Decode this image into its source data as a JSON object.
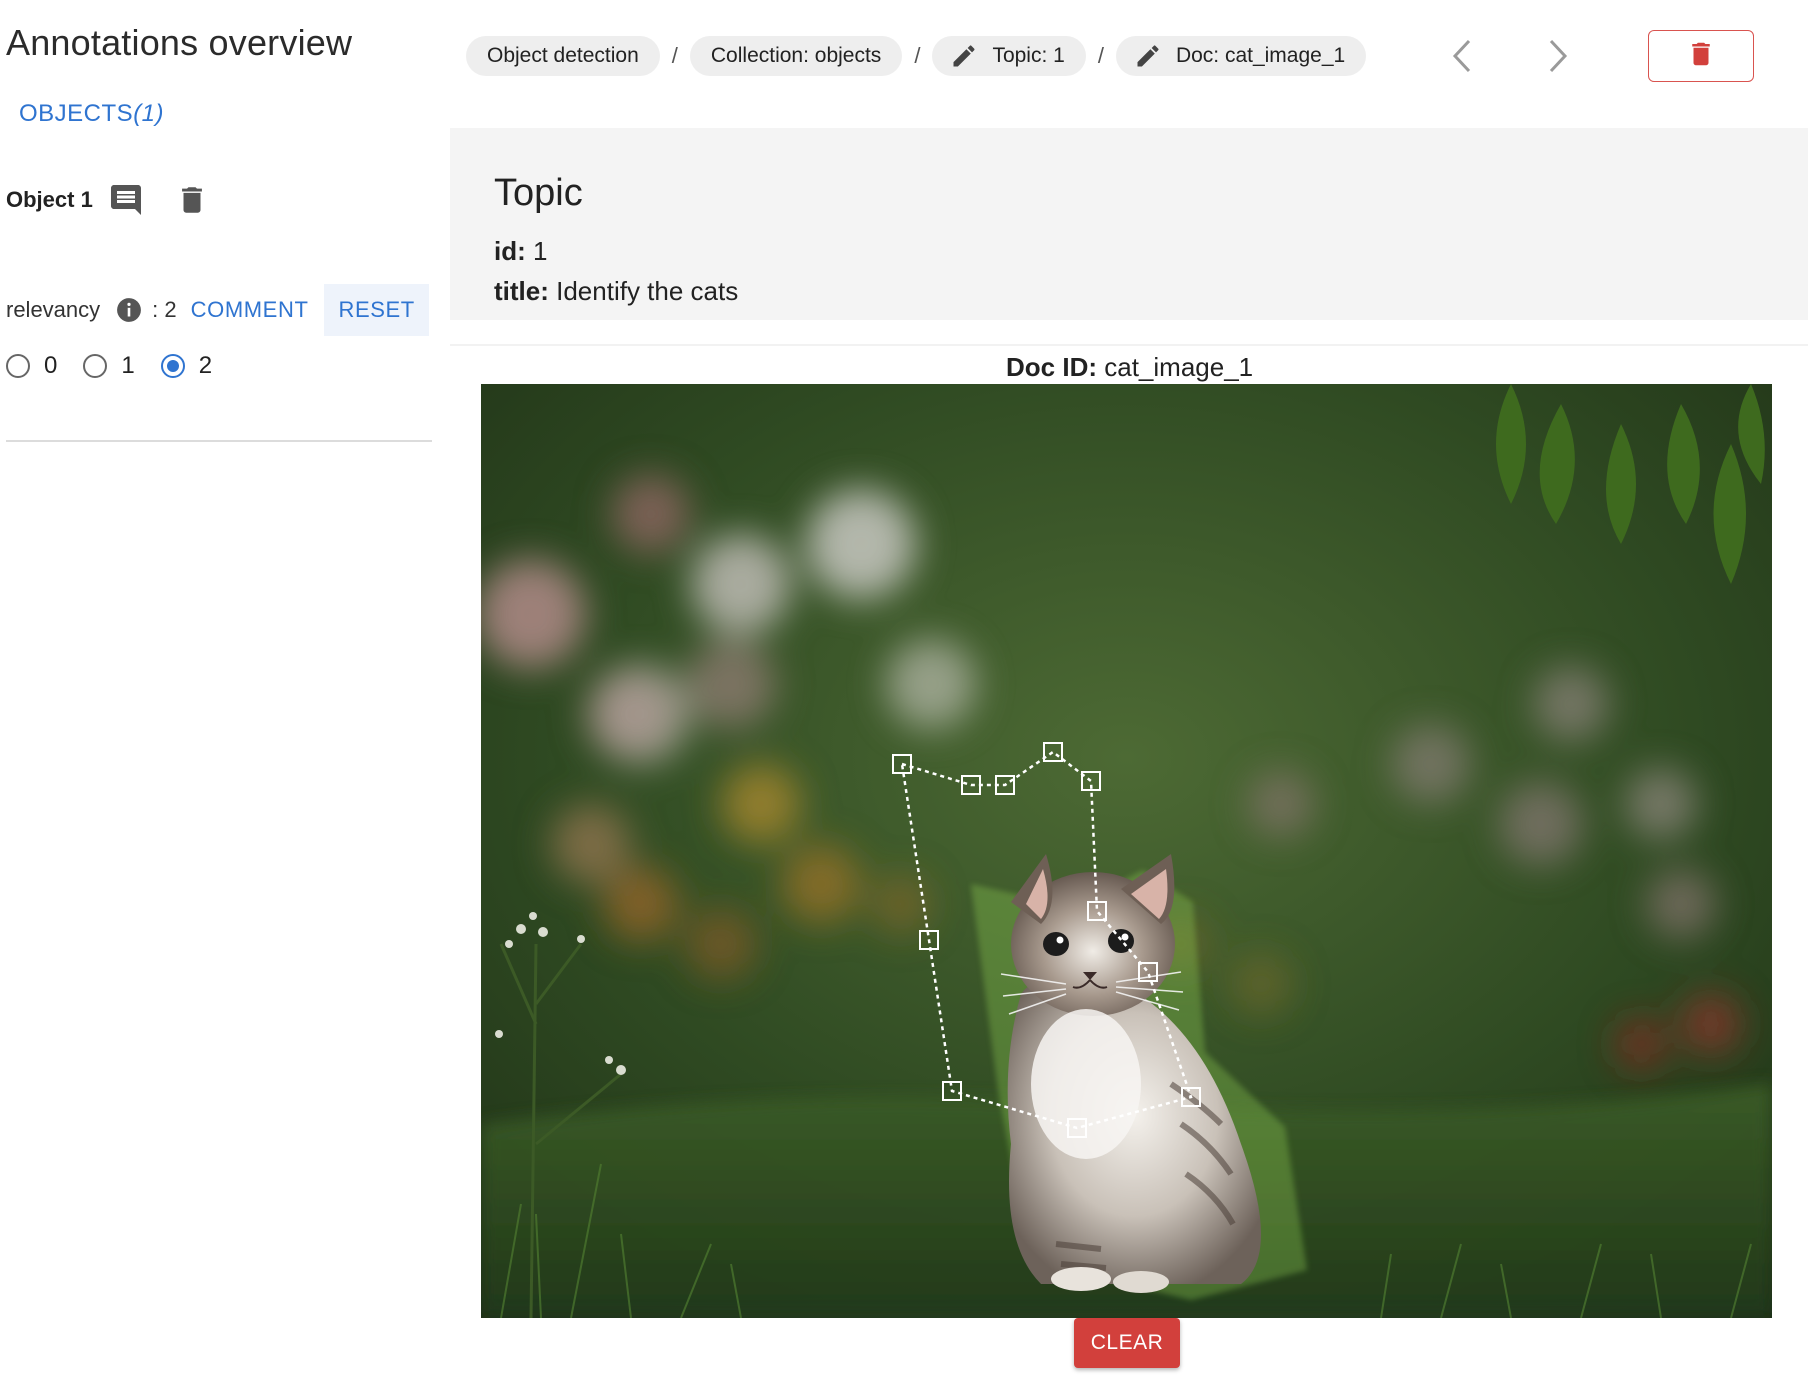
{
  "sidebar": {
    "title": "Annotations overview",
    "objects_tab": {
      "label": "OBJECTS",
      "count": "(1)"
    },
    "object": {
      "name": "Object 1",
      "comment_icon": "comment-icon",
      "delete_icon": "trash-icon"
    },
    "relevancy": {
      "label": "relevancy",
      "info_icon": "info-icon",
      "value": ": 2",
      "comment_label": "COMMENT",
      "reset_label": "RESET",
      "options": [
        "0",
        "1",
        "2"
      ],
      "selected": "2"
    }
  },
  "breadcrumb": {
    "items": [
      {
        "label": "Object detection",
        "icon": ""
      },
      {
        "label": "Collection: objects",
        "icon": ""
      },
      {
        "label": "Topic: 1",
        "icon": "pencil-icon"
      },
      {
        "label": "Doc: cat_image_1",
        "icon": "pencil-icon"
      }
    ],
    "separator": "/",
    "prev_icon": "chevron-left-icon",
    "next_icon": "chevron-right-icon",
    "delete_icon": "trash-icon"
  },
  "topic": {
    "heading": "Topic",
    "id_label": "id:",
    "id_value": "1",
    "title_label": "title:",
    "title_value": "Identify the cats"
  },
  "document": {
    "doc_id_label": "Doc ID:",
    "doc_id_value": "cat_image_1",
    "clear_label": "CLEAR"
  },
  "colors": {
    "accent": "#2f74d0",
    "danger": "#d2403c",
    "panel": "#f4f4f4",
    "chip": "#eeeeee"
  }
}
